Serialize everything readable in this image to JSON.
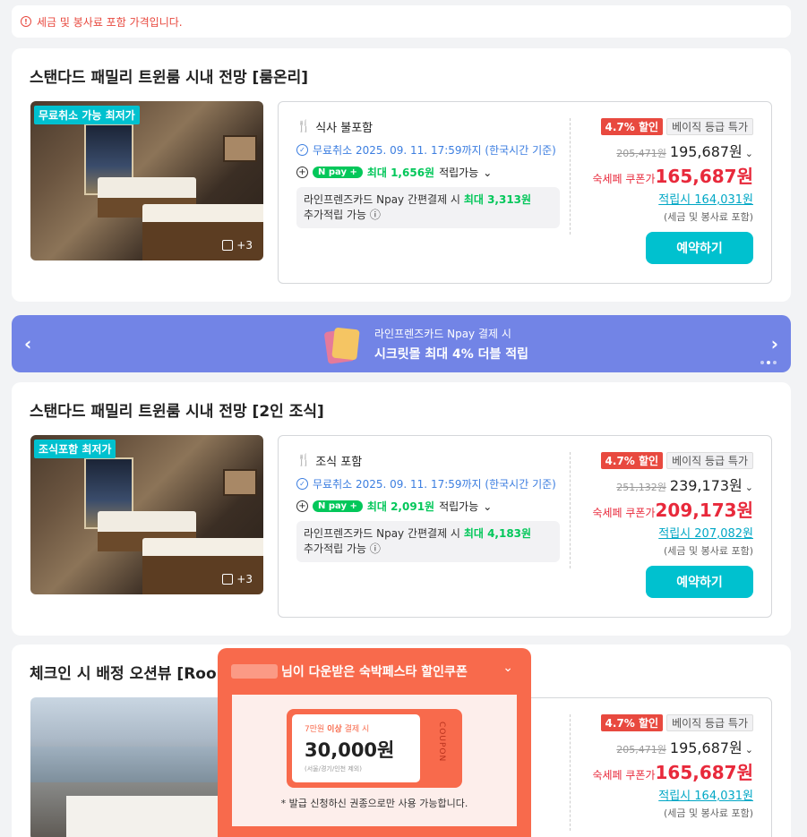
{
  "notice": "세금 및 봉사료 포함 가격입니다.",
  "rooms": [
    {
      "title": "스탠다드 패밀리 트윈룸 시내 전망 [룸온리]",
      "badge": "무료취소 가능 최저가",
      "photo_count": "+3",
      "meal": "식사 불포함",
      "cancel": "무료취소 2025. 09. 11. 17:59까지 (한국시간 기준)",
      "npay_label": "N pay +",
      "npay_max": "최대 1,656원",
      "npay_suffix": "적립가능",
      "card_line1_prefix": "라인프렌즈카드 Npay 간편결제 시",
      "card_line1_max": "최대 3,313원",
      "card_line2": "추가적립 가능",
      "discount": "4.7% 할인",
      "grade": "베이직 등급 특가",
      "old_price": "205,471원",
      "price": "195,687원",
      "coupon_label": "숙세페 쿠폰가",
      "coupon_price": "165,687원",
      "earn": "적립시 164,031원",
      "tax": "(세금 및 봉사료 포함)",
      "book": "예약하기"
    },
    {
      "title": "스탠다드 패밀리 트윈룸 시내 전망 [2인 조식]",
      "badge": "조식포함 최저가",
      "photo_count": "+3",
      "meal": "조식 포함",
      "cancel": "무료취소 2025. 09. 11. 17:59까지 (한국시간 기준)",
      "npay_label": "N pay +",
      "npay_max": "최대 2,091원",
      "npay_suffix": "적립가능",
      "card_line1_prefix": "라인프렌즈카드 Npay 간편결제 시",
      "card_line1_max": "최대 4,183원",
      "card_line2": "추가적립 가능",
      "discount": "4.7% 할인",
      "grade": "베이직 등급 특가",
      "old_price": "251,132원",
      "price": "239,173원",
      "coupon_label": "숙세페 쿠폰가",
      "coupon_price": "209,173원",
      "earn": "적립시 207,082원",
      "tax": "(세금 및 봉사료 포함)",
      "book": "예약하기"
    },
    {
      "title": "체크인 시 배정 오션뷰 [Roo",
      "cancel_partial": "준)",
      "discount": "4.7% 할인",
      "grade": "베이직 등급 특가",
      "old_price": "205,471원",
      "price": "195,687원",
      "coupon_label": "숙세페 쿠폰가",
      "coupon_price": "165,687원",
      "earn": "적립시 164,031원",
      "tax": "(세금 및 봉사료 포함)"
    }
  ],
  "banner": {
    "line1": "라인프렌즈카드 Npay 결제 시",
    "line2": "시크릿몰 최대 4% 더블 적립"
  },
  "popup": {
    "title": "님이 다운받은 숙박페스타 할인쿠폰",
    "condition_prefix": "7만원",
    "condition_bold": "이상",
    "condition_suffix": "결제 시",
    "amount": "30,000원",
    "region": "(서울/경기/인천 제외)",
    "side": "COUPON",
    "note": "* 발급 신청하신 권종으로만 사용 가능합니다."
  }
}
